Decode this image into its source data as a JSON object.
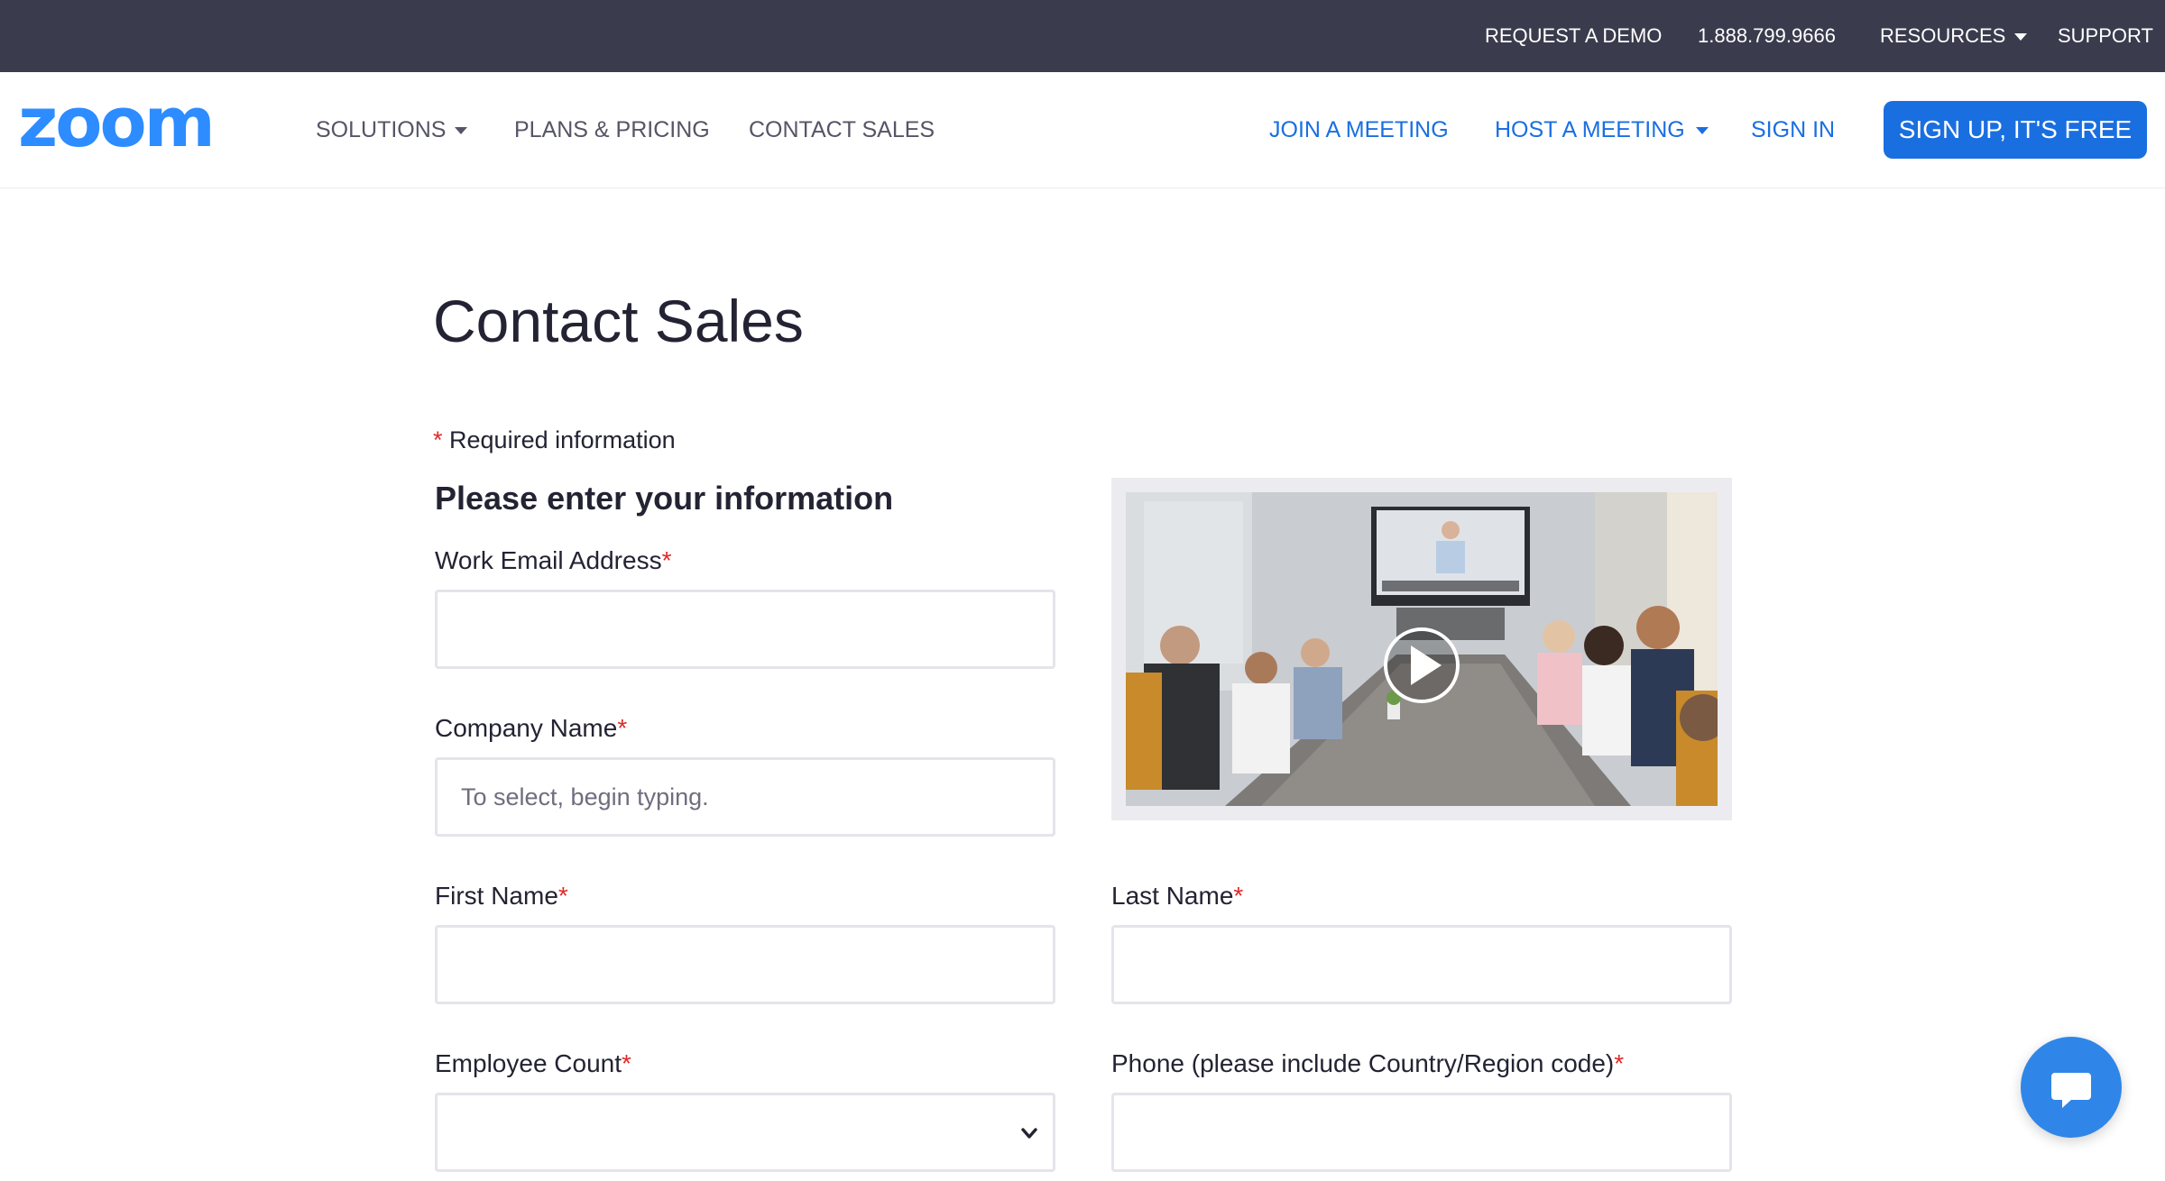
{
  "topbar": {
    "request_demo": "REQUEST A DEMO",
    "phone": "1.888.799.9666",
    "resources": "RESOURCES",
    "support": "SUPPORT"
  },
  "nav": {
    "logo_text": "zoom",
    "solutions": "SOLUTIONS",
    "plans_pricing": "PLANS & PRICING",
    "contact_sales": "CONTACT SALES",
    "join_meeting": "JOIN A MEETING",
    "host_meeting": "HOST A MEETING",
    "sign_in": "SIGN IN",
    "sign_up": "SIGN UP, IT'S FREE"
  },
  "page": {
    "title": "Contact Sales",
    "required_note": "Required information",
    "section_title": "Please enter your information"
  },
  "form": {
    "required_marker": "*",
    "work_email": {
      "label": "Work Email Address",
      "value": "",
      "placeholder": ""
    },
    "company_name": {
      "label": "Company Name",
      "value": "",
      "placeholder": "To select, begin typing."
    },
    "first_name": {
      "label": "First Name",
      "value": "",
      "placeholder": ""
    },
    "last_name": {
      "label": "Last Name",
      "value": "",
      "placeholder": ""
    },
    "employee_count": {
      "label": "Employee Count",
      "selected": ""
    },
    "phone": {
      "label": "Phone (please include Country/Region code)",
      "value": "",
      "placeholder": ""
    }
  },
  "icons": {
    "resources_caret": "caret-down-icon",
    "solutions_caret": "caret-down-icon",
    "host_caret": "caret-down-icon",
    "video_play": "play-icon",
    "select_chevron": "chevron-down-icon",
    "chat": "chat-bubble-icon"
  },
  "colors": {
    "topbar_bg": "#3a3b4d",
    "brand_blue": "#1a6fe0",
    "logo_blue": "#2d8cff",
    "required_red": "#e02828",
    "chat_blue": "#2f86e8"
  }
}
